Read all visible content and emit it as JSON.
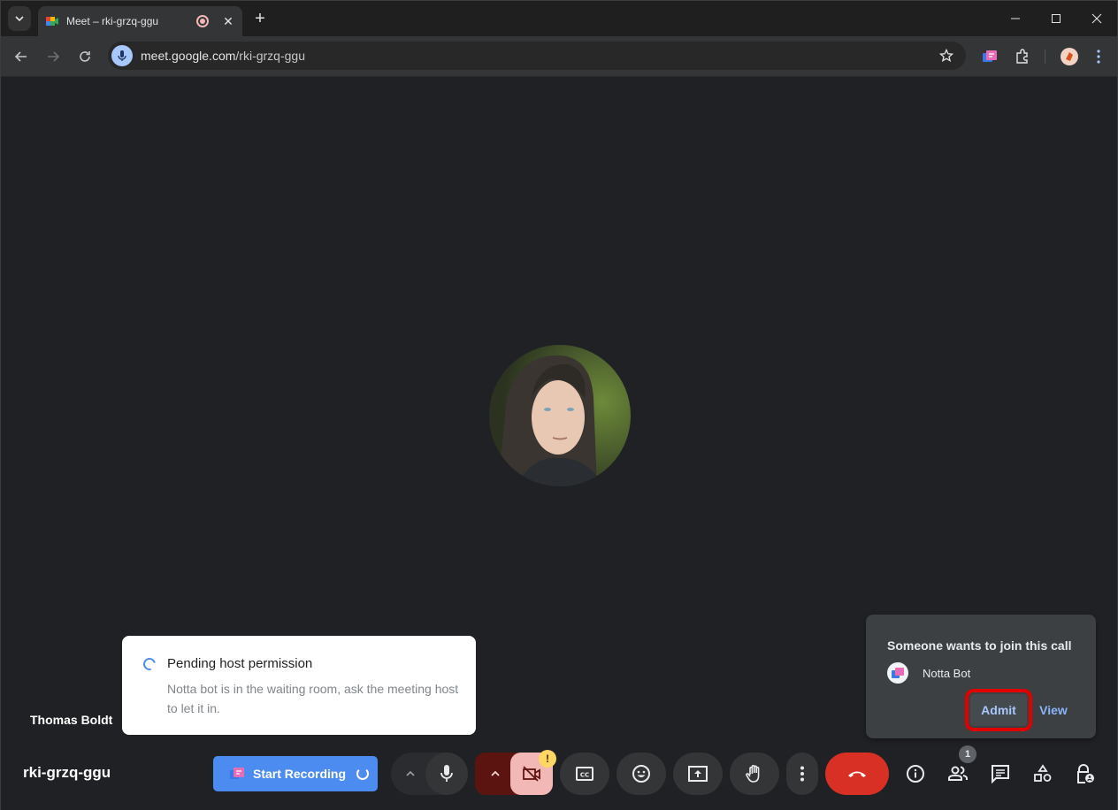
{
  "browser": {
    "tab": {
      "title": "Meet – rki-grzq-ggu"
    },
    "new_tab_label": "+",
    "url": {
      "host": "meet.google.com",
      "path": "/rki-grzq-ggu"
    },
    "window_controls": {
      "minimize": "minimize-icon",
      "maximize": "maximize-icon",
      "close": "close-icon"
    }
  },
  "stage": {
    "participant_name": "Thomas Boldt"
  },
  "pending_toast": {
    "title": "Pending host permission",
    "body": "Notta bot is in the waiting room, ask the meeting host to let it in."
  },
  "join_request": {
    "title": "Someone wants to join this call",
    "requester": "Notta Bot",
    "admit_label": "Admit",
    "view_label": "View"
  },
  "bottom_bar": {
    "meeting_code": "rki-grzq-ggu",
    "record_label": "Start Recording",
    "people_count": "1",
    "camera_warning": "!",
    "colors": {
      "end_call": "#d93025",
      "record": "#4c8bf0",
      "camera_off": "#f2b8b5",
      "highlight_outline": "#e00000"
    }
  }
}
